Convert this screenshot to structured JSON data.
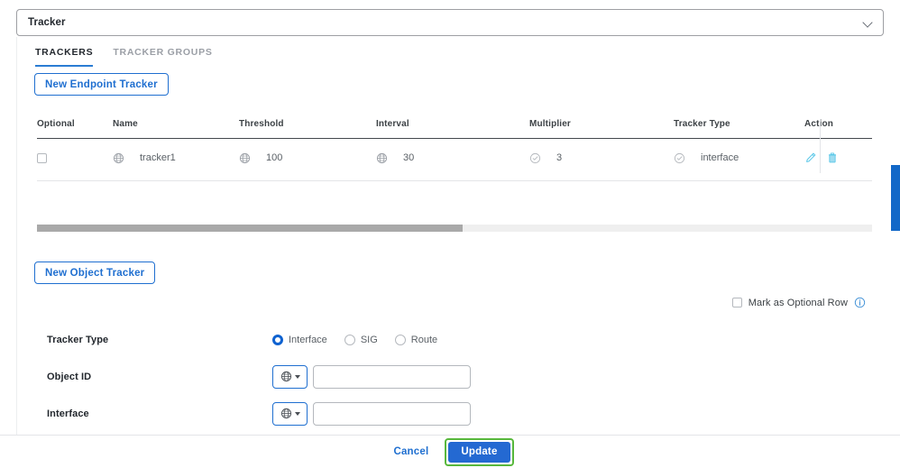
{
  "top_select": {
    "value": "Tracker",
    "chevron_icon": "chevron-down-icon"
  },
  "tabs": [
    {
      "label": "TRACKERS",
      "active": true
    },
    {
      "label": "TRACKER GROUPS",
      "active": false
    }
  ],
  "buttons": {
    "new_endpoint_tracker": "New Endpoint Tracker",
    "new_object_tracker": "New Object Tracker",
    "cancel": "Cancel",
    "update": "Update"
  },
  "table": {
    "columns": [
      "Optional",
      "Name",
      "Threshold",
      "Interval",
      "Multiplier",
      "Tracker Type",
      "Action"
    ],
    "rows": [
      {
        "optional": "",
        "name": "tracker1",
        "name_icon": "globe-icon",
        "threshold": "100",
        "threshold_icon": "globe-icon",
        "interval": "30",
        "interval_icon": "globe-icon",
        "multiplier": "3",
        "multiplier_icon": "check-circle-icon",
        "tracker_type": "interface",
        "tracker_type_icon": "check-circle-icon",
        "edit_icon": "pencil-icon",
        "delete_icon": "trash-icon"
      }
    ]
  },
  "scrollbars": {
    "horizontal_thumb_pct": 51,
    "vertical_thumb_color": "#1268c8"
  },
  "optional_row": {
    "label": "Mark as Optional Row",
    "checked": false,
    "info_icon": "info-icon"
  },
  "form": {
    "tracker_type": {
      "label": "Tracker Type",
      "options": [
        {
          "label": "Interface",
          "selected": true
        },
        {
          "label": "SIG",
          "selected": false
        },
        {
          "label": "Route",
          "selected": false
        }
      ]
    },
    "object_id": {
      "label": "Object ID",
      "dropdown_icon": "globe-icon",
      "value": "",
      "placeholder": ""
    },
    "interface": {
      "label": "Interface",
      "dropdown_icon": "globe-icon",
      "value": "",
      "placeholder": ""
    }
  },
  "colors": {
    "accent_blue": "#1f6fd0",
    "primary_button": "#2469d2",
    "focus_ring_green": "#58b83c",
    "icon_cyan": "#5bc8e8"
  }
}
